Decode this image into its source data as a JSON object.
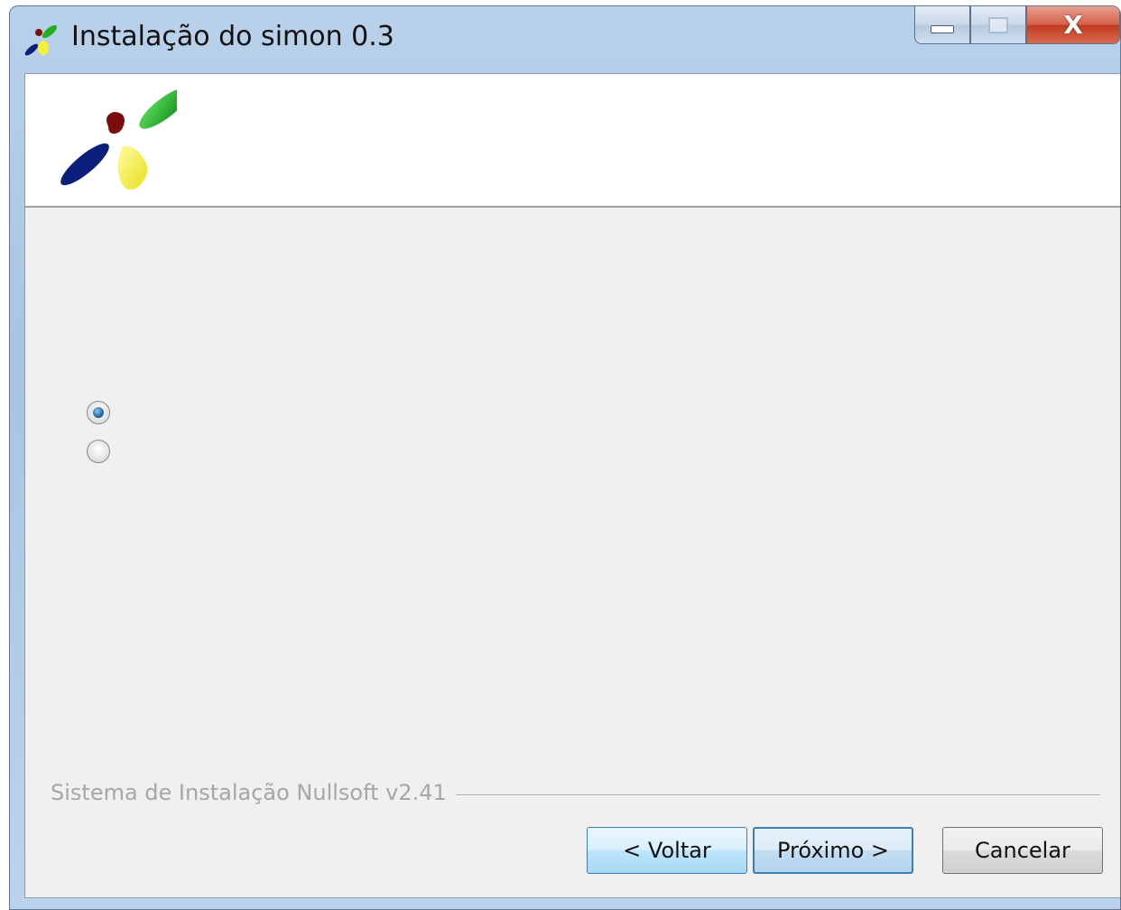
{
  "window": {
    "title": "Instalação do simon 0.3",
    "icon": "simon-logo-icon",
    "controls": {
      "minimize_icon": "minimize-icon",
      "maximize_icon": "maximize-icon",
      "close_label": "X"
    }
  },
  "header": {
    "logo": "simon-logo"
  },
  "options": [
    {
      "icon": "radio-button",
      "checked": true
    },
    {
      "icon": "radio-button",
      "checked": false
    }
  ],
  "branding": {
    "text": "Sistema de Instalação Nullsoft v2.41"
  },
  "buttons": {
    "back": "< Voltar",
    "next": "Próximo >",
    "cancel": "Cancelar"
  },
  "colors": {
    "logo_green": "#22b022",
    "logo_red": "#7a0e0e",
    "logo_blue": "#0c1f7a",
    "logo_yellow": "#f6f03a",
    "button_hover_blue": "#3c7fb1"
  }
}
